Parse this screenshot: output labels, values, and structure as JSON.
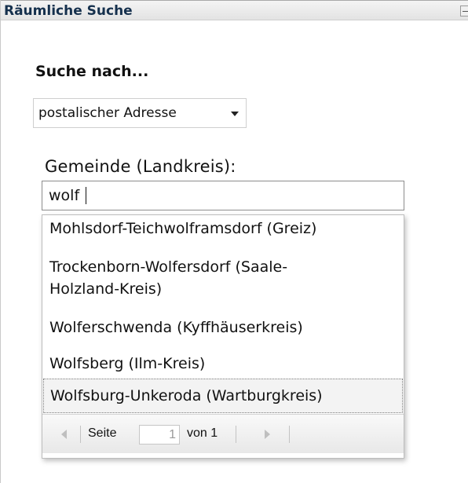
{
  "panel": {
    "title": "Räumliche Suche"
  },
  "search": {
    "heading": "Suche nach...",
    "mode_value": "postalischer Adresse",
    "field_label": "Gemeinde (Landkreis):",
    "query": "wolf"
  },
  "suggestions": [
    {
      "label": "Mohlsdorf-Teichwolframsdorf (Greiz)",
      "selected": false
    },
    {
      "label": "Trockenborn-Wolfersdorf (Saale-",
      "label_line2": "Holzland-Kreis)",
      "selected": false
    },
    {
      "label": "Wolferschwenda (Kyffhäuserkreis)",
      "selected": false
    },
    {
      "label": "Wolfsberg (Ilm-Kreis)",
      "selected": false
    },
    {
      "label": "Wolfsburg-Unkeroda (Wartburgkreis)",
      "selected": true
    }
  ],
  "pager": {
    "page_label": "Seite",
    "page_value": "1",
    "of_label": "von 1"
  },
  "icons": {
    "collapse": "minimize-icon",
    "select_arrow": "chevron-down-icon",
    "prev": "prev-page-icon",
    "next": "next-page-icon"
  }
}
